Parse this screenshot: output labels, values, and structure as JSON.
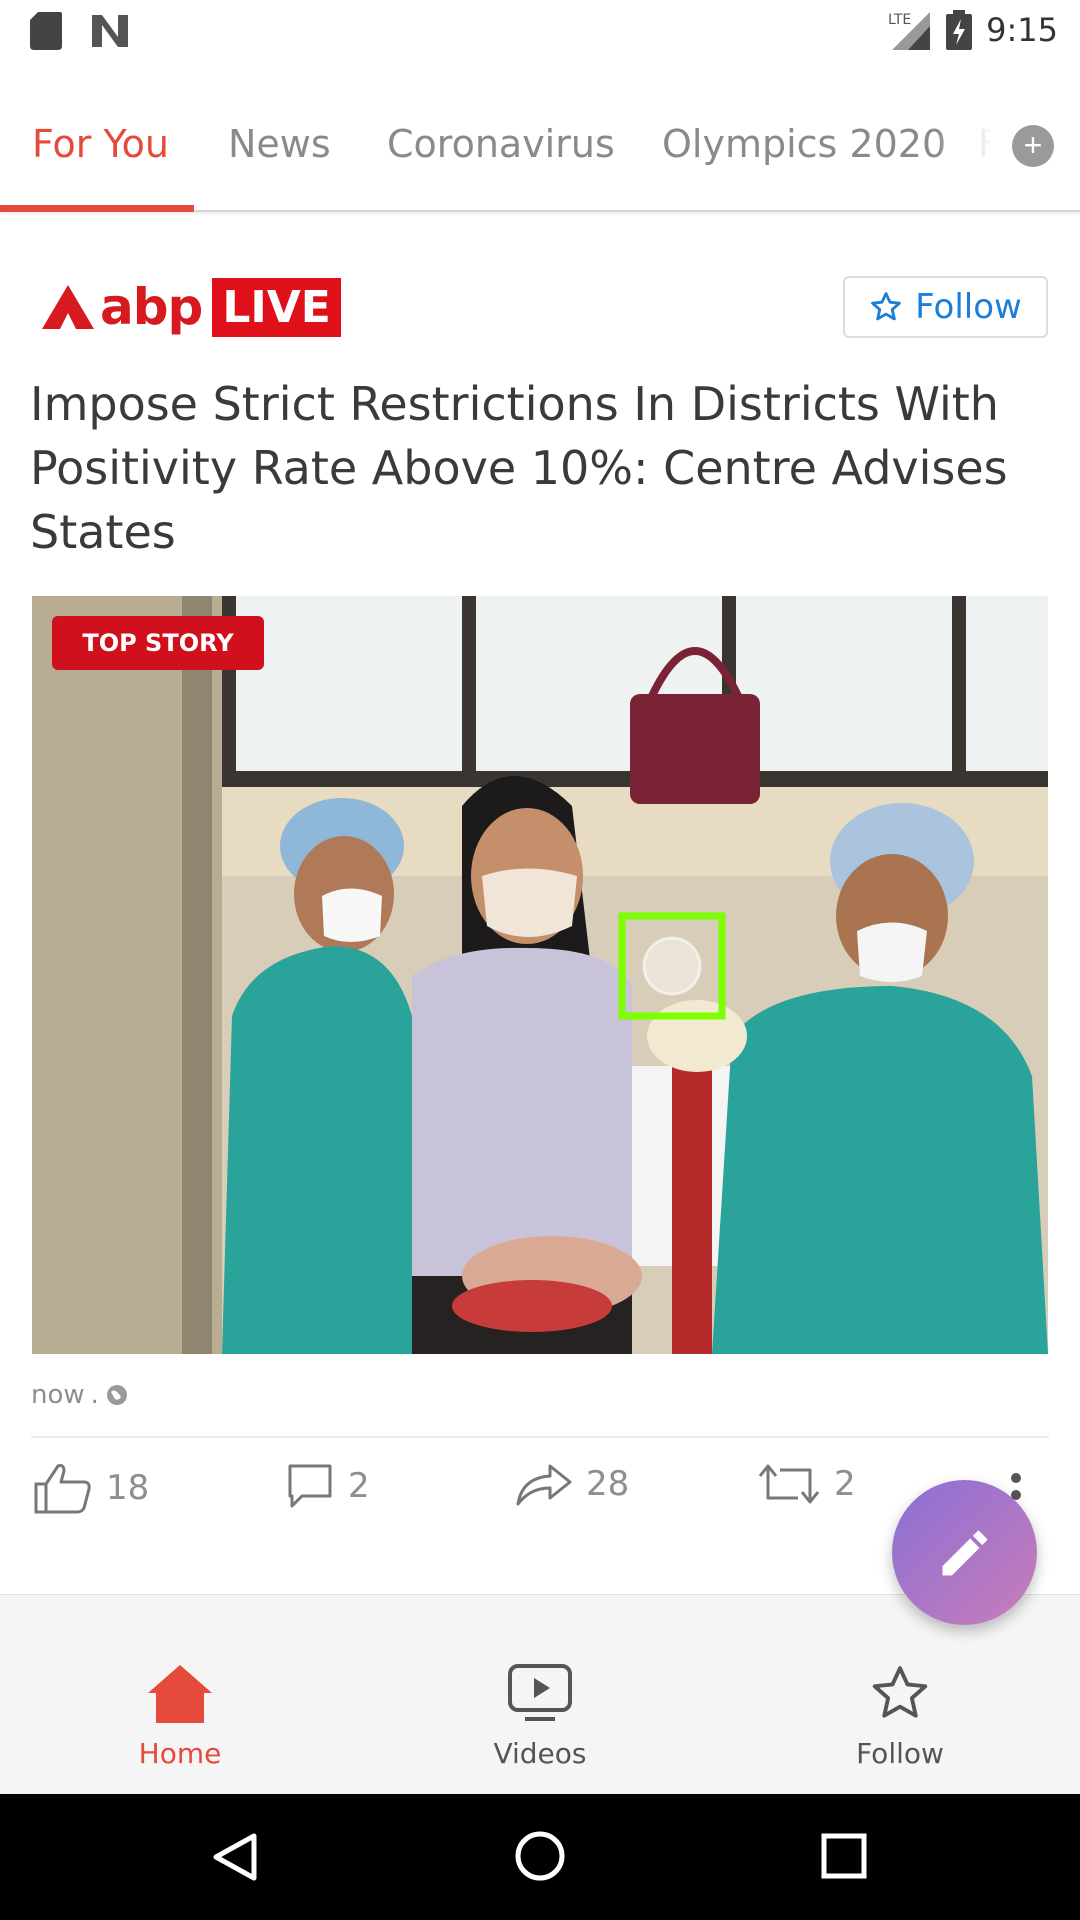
{
  "status_bar": {
    "time": "9:15",
    "network": "LTE",
    "icons": [
      "sd-card-icon",
      "n-logo-icon",
      "signal-icon",
      "battery-charging-icon"
    ]
  },
  "tabs": [
    {
      "label": "For You",
      "active": true
    },
    {
      "label": "News",
      "active": false
    },
    {
      "label": "Coronavirus",
      "active": false
    },
    {
      "label": "Olympics 2020",
      "active": false
    },
    {
      "label": "F",
      "active": false
    }
  ],
  "tabs_more_label": "+",
  "publisher": {
    "logo_text": "abp",
    "logo_badge": "LIVE",
    "follow_label": "Follow"
  },
  "article": {
    "headline": "Impose Strict Restrictions In Districts With Positivity Rate Above 10%: Centre Advises States",
    "badge": "TOP STORY",
    "time": "now",
    "separator": "."
  },
  "actions": {
    "likes": "18",
    "comments": "2",
    "shares": "28",
    "reposts": "2"
  },
  "bottom_nav": [
    {
      "label": "Home",
      "icon": "home-icon",
      "active": true
    },
    {
      "label": "Videos",
      "icon": "video-icon",
      "active": false
    },
    {
      "label": "Follow",
      "icon": "star-icon",
      "active": false
    }
  ],
  "colors": {
    "accent": "#e64a3b",
    "link": "#1c7ed6",
    "badge": "#d0101c",
    "fab_start": "#8a6fd6",
    "fab_end": "#c97db8"
  }
}
